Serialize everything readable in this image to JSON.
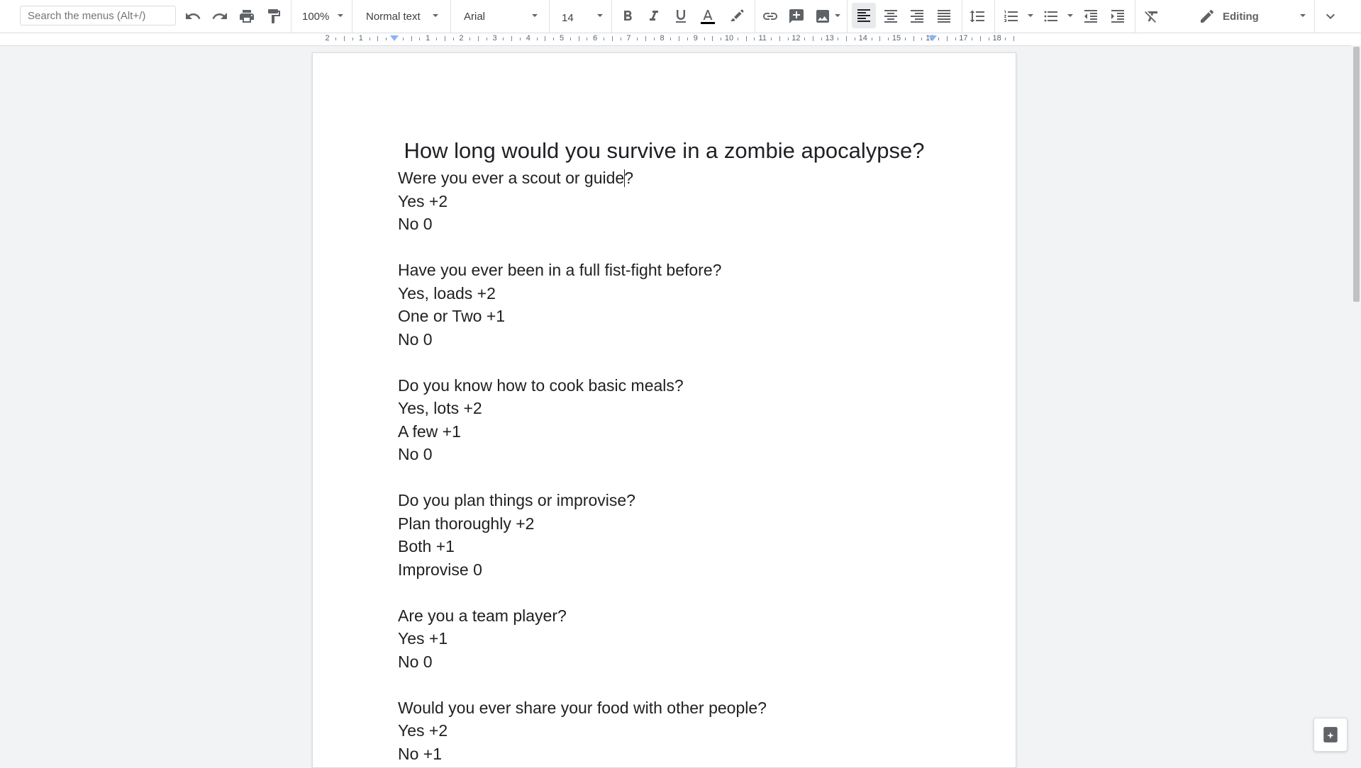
{
  "toolbar": {
    "search_placeholder": "Search the menus (Alt+/)",
    "zoom": "100%",
    "style": "Normal text",
    "font": "Arial",
    "font_size": "14",
    "mode": "Editing",
    "text_color": "#000000"
  },
  "ruler": {
    "numbers": [
      "2",
      "1",
      "1",
      "2",
      "3",
      "4",
      "5",
      "6",
      "7",
      "8",
      "9",
      "10",
      "11",
      "12",
      "13",
      "14",
      "15",
      "16",
      "17",
      "18"
    ]
  },
  "document": {
    "title": "How long would you survive in a zombie apocalypse?",
    "first_line_before_cursor": "Were you ever a scout or guide",
    "first_line_after_cursor": "?",
    "lines": [
      "Yes +2",
      "No 0",
      "",
      "Have you ever been in a full fist-fight before?",
      "Yes, loads +2",
      "One or Two +1",
      "No 0",
      "",
      "Do you know how to cook basic meals?",
      "Yes, lots +2",
      "A few +1",
      "No 0",
      "",
      "Do you plan things or improvise?",
      "Plan thoroughly +2",
      "Both +1",
      "Improvise 0",
      "",
      "Are you a team player?",
      "Yes +1",
      "No 0",
      "",
      "Would you ever share your food with other people?",
      "Yes +2",
      "No +1"
    ]
  },
  "colors": {
    "accent_blue": "#8ab4f8",
    "toolbar_icon": "#5f6368"
  }
}
